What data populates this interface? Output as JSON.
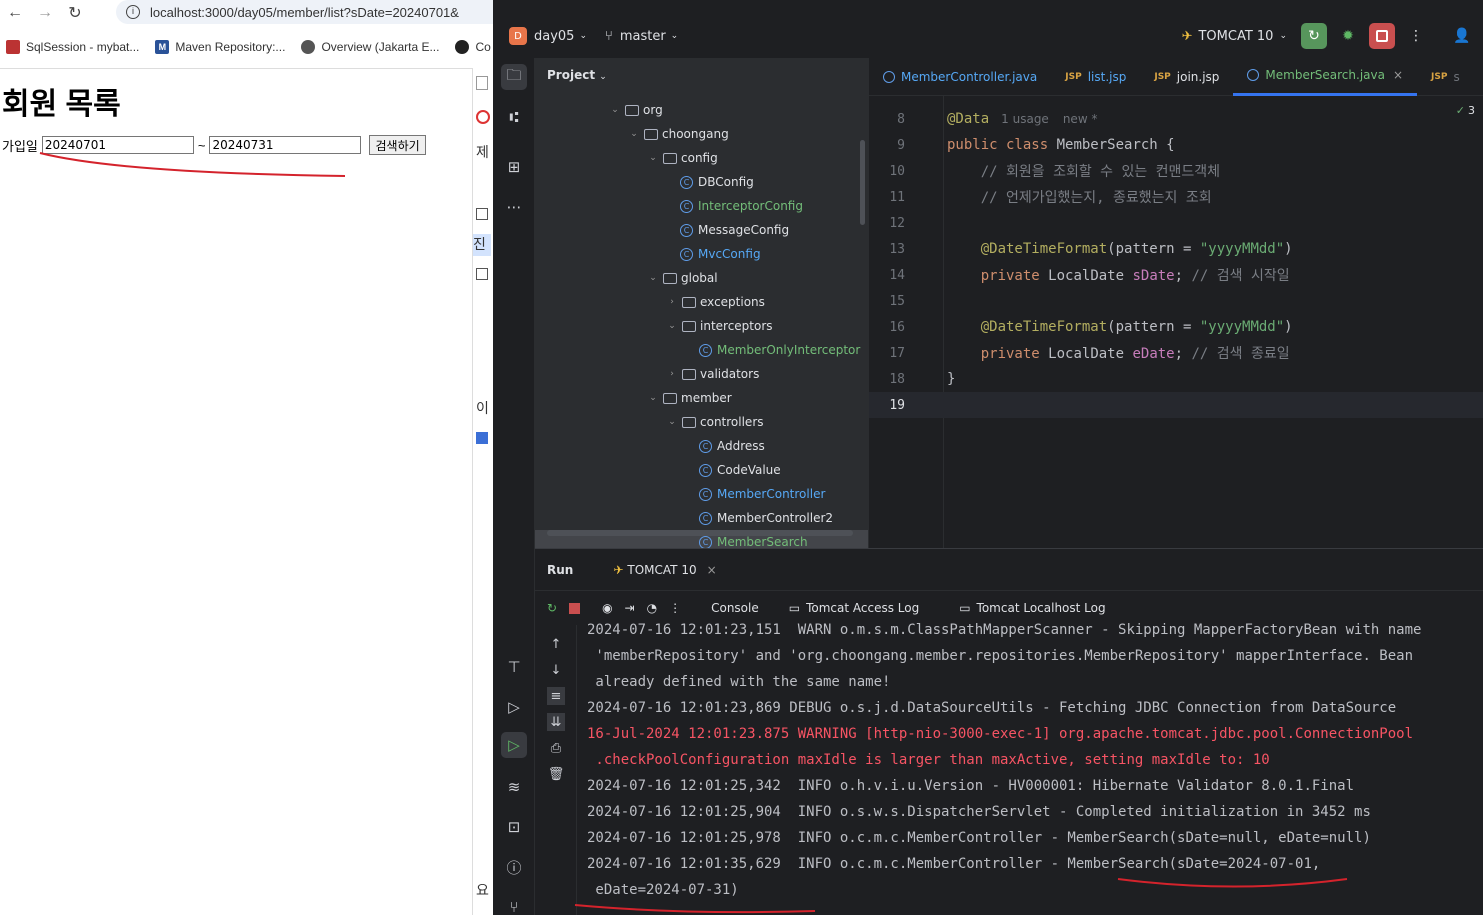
{
  "browser": {
    "url": "localhost:3000/day05/member/list?sDate=20240701&",
    "bookmarks": [
      {
        "label": "SqlSession - mybat...",
        "icon": "bookmark-icon"
      },
      {
        "label": "Maven Repository:...",
        "icon": "mvn-icon"
      },
      {
        "label": "Overview (Jakarta E...",
        "icon": "globe-icon"
      },
      {
        "label": "Co",
        "icon": "github-icon"
      }
    ],
    "page": {
      "title": "회원 목록",
      "date_label": "가입일",
      "start_date": "20240701",
      "separator": "~",
      "end_date": "20240731",
      "search_button": "검색하기"
    },
    "right_strip": [
      "제",
      "진",
      "이",
      "요"
    ]
  },
  "ide": {
    "project_badge": "D",
    "project_name": "day05",
    "branch": "master",
    "run_config": "TOMCAT 10",
    "project_panel_title": "Project",
    "tree": [
      {
        "label": "org",
        "type": "folder",
        "depth": 4,
        "open": true
      },
      {
        "label": "choongang",
        "type": "folder",
        "depth": 5,
        "open": true
      },
      {
        "label": "config",
        "type": "folder",
        "depth": 6,
        "open": true
      },
      {
        "label": "DBConfig",
        "type": "class",
        "depth": 7,
        "color": "#dfe1e5"
      },
      {
        "label": "InterceptorConfig",
        "type": "class",
        "depth": 7,
        "color": "#73bd79"
      },
      {
        "label": "MessageConfig",
        "type": "class",
        "depth": 7,
        "color": "#dfe1e5"
      },
      {
        "label": "MvcConfig",
        "type": "class",
        "depth": 7,
        "color": "#56a8f5"
      },
      {
        "label": "global",
        "type": "folder",
        "depth": 6,
        "open": true
      },
      {
        "label": "exceptions",
        "type": "folder",
        "depth": 7,
        "open": false
      },
      {
        "label": "interceptors",
        "type": "folder",
        "depth": 7,
        "open": true
      },
      {
        "label": "MemberOnlyInterceptor",
        "type": "class",
        "depth": 8,
        "color": "#73bd79"
      },
      {
        "label": "validators",
        "type": "folder",
        "depth": 7,
        "open": false
      },
      {
        "label": "member",
        "type": "folder",
        "depth": 6,
        "open": true
      },
      {
        "label": "controllers",
        "type": "folder",
        "depth": 7,
        "open": true
      },
      {
        "label": "Address",
        "type": "class",
        "depth": 8,
        "color": "#dfe1e5"
      },
      {
        "label": "CodeValue",
        "type": "class",
        "depth": 8,
        "color": "#dfe1e5"
      },
      {
        "label": "MemberController",
        "type": "class",
        "depth": 8,
        "color": "#56a8f5"
      },
      {
        "label": "MemberController2",
        "type": "class",
        "depth": 8,
        "color": "#dfe1e5"
      },
      {
        "label": "MemberSearch",
        "type": "class",
        "depth": 8,
        "color": "#73bd79"
      }
    ],
    "tabs": [
      {
        "label": "MemberController.java",
        "kind": "class",
        "color": "#56a8f5",
        "active": false
      },
      {
        "label": "list.jsp",
        "kind": "jsp",
        "color": "#56a8f5",
        "active": false
      },
      {
        "label": "join.jsp",
        "kind": "jsp",
        "color": "#dfe1e5",
        "active": false
      },
      {
        "label": "MemberSearch.java",
        "kind": "class",
        "color": "#73bd79",
        "active": true
      },
      {
        "label": "s",
        "kind": "jsp",
        "color": "#6f737a",
        "active": false
      }
    ],
    "inspection_count": "3",
    "code_hint": {
      "usage": "1 usage",
      "new": "new *"
    },
    "code": [
      {
        "n": "8",
        "html": "<span class='an'>@Data</span>"
      },
      {
        "n": "9",
        "html": "<span class='kw'>public class</span> <span class='pl'>MemberSearch {</span>"
      },
      {
        "n": "10",
        "html": "    <span class='cm'>// 회원을 조회할 수 있는 컨맨드객체</span>"
      },
      {
        "n": "11",
        "html": "    <span class='cm'>// 언제가입했는지, 종료했는지 조회</span>"
      },
      {
        "n": "12",
        "html": ""
      },
      {
        "n": "13",
        "html": "    <span class='an'>@DateTimeFormat</span><span class='pl'>(pattern = </span><span class='st'>\"yyyyMMdd\"</span><span class='pl'>)</span>"
      },
      {
        "n": "14",
        "html": "    <span class='kw'>private</span> <span class='pl'>LocalDate </span><span class='fd'>sDate</span><span class='pl'>; </span><span class='cm'>// 검색 시작일</span>"
      },
      {
        "n": "15",
        "html": ""
      },
      {
        "n": "16",
        "html": "    <span class='an'>@DateTimeFormat</span><span class='pl'>(pattern = </span><span class='st'>\"yyyyMMdd\"</span><span class='pl'>)</span>"
      },
      {
        "n": "17",
        "html": "    <span class='kw'>private</span> <span class='pl'>LocalDate </span><span class='fd'>eDate</span><span class='pl'>; </span><span class='cm'>// 검색 종료일</span>"
      },
      {
        "n": "18",
        "html": "<span class='pl'>}</span>"
      },
      {
        "n": "19",
        "html": ""
      }
    ],
    "run": {
      "title": "Run",
      "tab": "TOMCAT 10",
      "tool_tabs": [
        "Console",
        "Tomcat Access Log",
        "Tomcat Localhost Log"
      ],
      "log": [
        {
          "text": "2024-07-16 12:01:23,151  WARN o.m.s.m.ClassPathMapperScanner - Skipping MapperFactoryBean with name",
          "warn": false
        },
        {
          "text": " 'memberRepository' and 'org.choongang.member.repositories.MemberRepository' mapperInterface. Bean",
          "warn": false
        },
        {
          "text": " already defined with the same name!",
          "warn": false
        },
        {
          "text": "2024-07-16 12:01:23,869 DEBUG o.s.j.d.DataSourceUtils - Fetching JDBC Connection from DataSource",
          "warn": false
        },
        {
          "text": "16-Jul-2024 12:01:23.875 WARNING [http-nio-3000-exec-1] org.apache.tomcat.jdbc.pool.ConnectionPool",
          "warn": true
        },
        {
          "text": " .checkPoolConfiguration maxIdle is larger than maxActive, setting maxIdle to: 10",
          "warn": true
        },
        {
          "text": "2024-07-16 12:01:25,342  INFO o.h.v.i.u.Version - HV000001: Hibernate Validator 8.0.1.Final",
          "warn": false
        },
        {
          "text": "2024-07-16 12:01:25,904  INFO o.s.w.s.DispatcherServlet - Completed initialization in 3452 ms",
          "warn": false
        },
        {
          "text": "2024-07-16 12:01:25,978  INFO o.c.m.c.MemberController - MemberSearch(sDate=null, eDate=null)",
          "warn": false
        },
        {
          "text": "2024-07-16 12:01:35,629  INFO o.c.m.c.MemberController - MemberSearch(sDate=2024-07-01,",
          "warn": false
        },
        {
          "text": " eDate=2024-07-31)",
          "warn": false
        }
      ]
    }
  }
}
